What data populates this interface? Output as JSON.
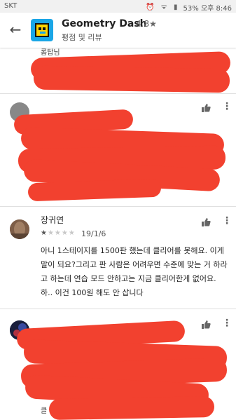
{
  "status_bar": {
    "carrier": "SKT",
    "battery": "53%",
    "time": "오후 8:46"
  },
  "app_bar": {
    "app_name": "Geometry Dash",
    "rating": "4.8★",
    "subtitle": "평점 및 리뷰"
  },
  "reviews": [
    {
      "author": "",
      "stars": "",
      "date": "",
      "text": ""
    },
    {
      "author": "장귀연",
      "stars_filled": 1,
      "stars_total": 5,
      "date": "19/1/6",
      "text": "아니 1스테이지를 1500판 했는데 클리어를 못해요. 이게 말이 되요?그리고 판 사람은 어려우면 수준에 맞는 거 하라고 하는데 연습 모드 안하고는 지금 클리어한게 없어요. 하.. 이건 100원 해도 안 삽니다"
    },
    {
      "author": "",
      "stars": "",
      "date": "",
      "text": ""
    }
  ],
  "peeks": {
    "top_fragment": "롭탑님",
    "bottom_fragment": "클"
  },
  "colors": {
    "scribble": "#f2412f",
    "app_icon": "#1aa6e6"
  },
  "icons": [
    "back-arrow-icon",
    "thumbs-up-icon",
    "more-vertical-icon",
    "game-face-icon"
  ]
}
